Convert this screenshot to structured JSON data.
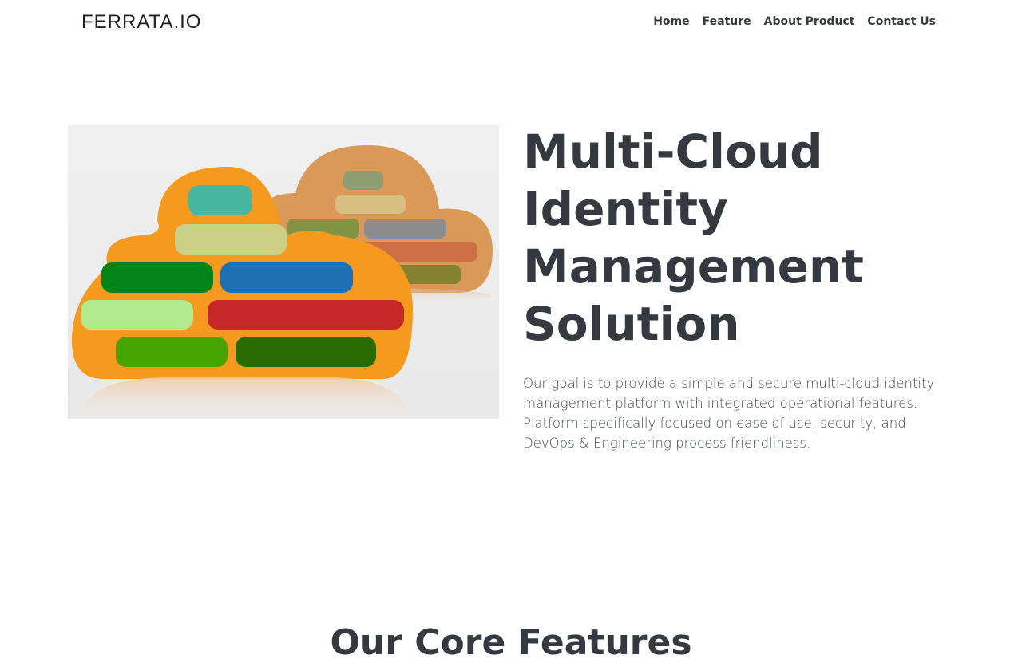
{
  "navbar": {
    "brand": "FERRATA.IO",
    "links": [
      {
        "label": "Home"
      },
      {
        "label": "Feature"
      },
      {
        "label": "About Product"
      },
      {
        "label": "Contact Us"
      }
    ]
  },
  "hero": {
    "title_lines": [
      "Multi-Cloud",
      "Identity",
      "Management",
      "Solution"
    ],
    "description": "Our goal is to provide a simple and secure multi-cloud identity management platform with integrated operational features. Platform specifically focused on ease of use, security, and DevOps & Engineering process friendliness."
  },
  "features": {
    "title": "Our Core Features"
  },
  "colors": {
    "text": "#343a40",
    "cloud_front": "#f59a1f",
    "cloud_back": "#d9954e"
  }
}
